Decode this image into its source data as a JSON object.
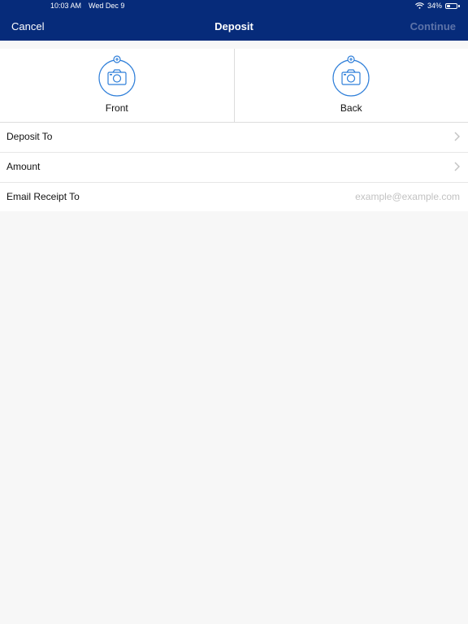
{
  "status_bar": {
    "time": "10:03 AM",
    "date": "Wed Dec 9",
    "battery": "34%",
    "wifi_icon": "wifi-icon",
    "battery_icon": "battery-icon"
  },
  "nav": {
    "cancel_label": "Cancel",
    "title": "Deposit",
    "continue_label": "Continue"
  },
  "capture": {
    "front_label": "Front",
    "back_label": "Back",
    "icon": "camera-add-icon"
  },
  "form": {
    "rows": [
      {
        "label": "Deposit To",
        "icon": "chevron-right-icon"
      },
      {
        "label": "Amount",
        "icon": "chevron-right-icon"
      },
      {
        "label": "Email Receipt To",
        "placeholder": "example@example.com",
        "value": ""
      }
    ]
  },
  "colors": {
    "header_bg": "#062b7a",
    "accent_icon": "#2f7fd9",
    "continue_disabled": "#5d73a8",
    "background": "#f7f7f7"
  }
}
